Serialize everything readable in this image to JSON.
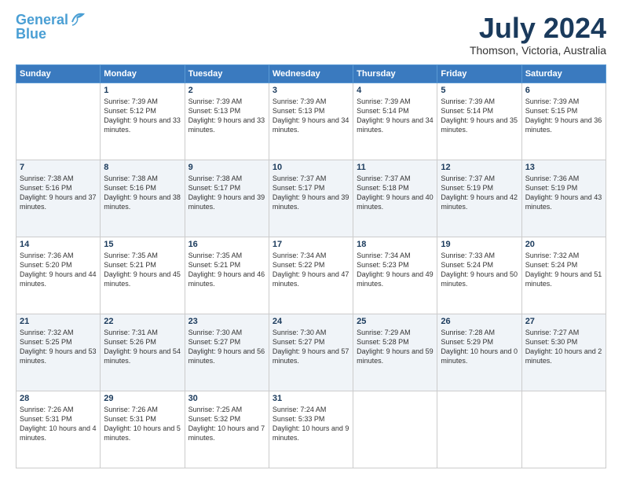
{
  "logo": {
    "line1": "General",
    "line2": "Blue"
  },
  "title": "July 2024",
  "subtitle": "Thomson, Victoria, Australia",
  "weekdays": [
    "Sunday",
    "Monday",
    "Tuesday",
    "Wednesday",
    "Thursday",
    "Friday",
    "Saturday"
  ],
  "weeks": [
    [
      {
        "day": "",
        "sunrise": "",
        "sunset": "",
        "daylight": ""
      },
      {
        "day": "1",
        "sunrise": "Sunrise: 7:39 AM",
        "sunset": "Sunset: 5:12 PM",
        "daylight": "Daylight: 9 hours and 33 minutes."
      },
      {
        "day": "2",
        "sunrise": "Sunrise: 7:39 AM",
        "sunset": "Sunset: 5:13 PM",
        "daylight": "Daylight: 9 hours and 33 minutes."
      },
      {
        "day": "3",
        "sunrise": "Sunrise: 7:39 AM",
        "sunset": "Sunset: 5:13 PM",
        "daylight": "Daylight: 9 hours and 34 minutes."
      },
      {
        "day": "4",
        "sunrise": "Sunrise: 7:39 AM",
        "sunset": "Sunset: 5:14 PM",
        "daylight": "Daylight: 9 hours and 34 minutes."
      },
      {
        "day": "5",
        "sunrise": "Sunrise: 7:39 AM",
        "sunset": "Sunset: 5:14 PM",
        "daylight": "Daylight: 9 hours and 35 minutes."
      },
      {
        "day": "6",
        "sunrise": "Sunrise: 7:39 AM",
        "sunset": "Sunset: 5:15 PM",
        "daylight": "Daylight: 9 hours and 36 minutes."
      }
    ],
    [
      {
        "day": "7",
        "sunrise": "Sunrise: 7:38 AM",
        "sunset": "Sunset: 5:16 PM",
        "daylight": "Daylight: 9 hours and 37 minutes."
      },
      {
        "day": "8",
        "sunrise": "Sunrise: 7:38 AM",
        "sunset": "Sunset: 5:16 PM",
        "daylight": "Daylight: 9 hours and 38 minutes."
      },
      {
        "day": "9",
        "sunrise": "Sunrise: 7:38 AM",
        "sunset": "Sunset: 5:17 PM",
        "daylight": "Daylight: 9 hours and 39 minutes."
      },
      {
        "day": "10",
        "sunrise": "Sunrise: 7:37 AM",
        "sunset": "Sunset: 5:17 PM",
        "daylight": "Daylight: 9 hours and 39 minutes."
      },
      {
        "day": "11",
        "sunrise": "Sunrise: 7:37 AM",
        "sunset": "Sunset: 5:18 PM",
        "daylight": "Daylight: 9 hours and 40 minutes."
      },
      {
        "day": "12",
        "sunrise": "Sunrise: 7:37 AM",
        "sunset": "Sunset: 5:19 PM",
        "daylight": "Daylight: 9 hours and 42 minutes."
      },
      {
        "day": "13",
        "sunrise": "Sunrise: 7:36 AM",
        "sunset": "Sunset: 5:19 PM",
        "daylight": "Daylight: 9 hours and 43 minutes."
      }
    ],
    [
      {
        "day": "14",
        "sunrise": "Sunrise: 7:36 AM",
        "sunset": "Sunset: 5:20 PM",
        "daylight": "Daylight: 9 hours and 44 minutes."
      },
      {
        "day": "15",
        "sunrise": "Sunrise: 7:35 AM",
        "sunset": "Sunset: 5:21 PM",
        "daylight": "Daylight: 9 hours and 45 minutes."
      },
      {
        "day": "16",
        "sunrise": "Sunrise: 7:35 AM",
        "sunset": "Sunset: 5:21 PM",
        "daylight": "Daylight: 9 hours and 46 minutes."
      },
      {
        "day": "17",
        "sunrise": "Sunrise: 7:34 AM",
        "sunset": "Sunset: 5:22 PM",
        "daylight": "Daylight: 9 hours and 47 minutes."
      },
      {
        "day": "18",
        "sunrise": "Sunrise: 7:34 AM",
        "sunset": "Sunset: 5:23 PM",
        "daylight": "Daylight: 9 hours and 49 minutes."
      },
      {
        "day": "19",
        "sunrise": "Sunrise: 7:33 AM",
        "sunset": "Sunset: 5:24 PM",
        "daylight": "Daylight: 9 hours and 50 minutes."
      },
      {
        "day": "20",
        "sunrise": "Sunrise: 7:32 AM",
        "sunset": "Sunset: 5:24 PM",
        "daylight": "Daylight: 9 hours and 51 minutes."
      }
    ],
    [
      {
        "day": "21",
        "sunrise": "Sunrise: 7:32 AM",
        "sunset": "Sunset: 5:25 PM",
        "daylight": "Daylight: 9 hours and 53 minutes."
      },
      {
        "day": "22",
        "sunrise": "Sunrise: 7:31 AM",
        "sunset": "Sunset: 5:26 PM",
        "daylight": "Daylight: 9 hours and 54 minutes."
      },
      {
        "day": "23",
        "sunrise": "Sunrise: 7:30 AM",
        "sunset": "Sunset: 5:27 PM",
        "daylight": "Daylight: 9 hours and 56 minutes."
      },
      {
        "day": "24",
        "sunrise": "Sunrise: 7:30 AM",
        "sunset": "Sunset: 5:27 PM",
        "daylight": "Daylight: 9 hours and 57 minutes."
      },
      {
        "day": "25",
        "sunrise": "Sunrise: 7:29 AM",
        "sunset": "Sunset: 5:28 PM",
        "daylight": "Daylight: 9 hours and 59 minutes."
      },
      {
        "day": "26",
        "sunrise": "Sunrise: 7:28 AM",
        "sunset": "Sunset: 5:29 PM",
        "daylight": "Daylight: 10 hours and 0 minutes."
      },
      {
        "day": "27",
        "sunrise": "Sunrise: 7:27 AM",
        "sunset": "Sunset: 5:30 PM",
        "daylight": "Daylight: 10 hours and 2 minutes."
      }
    ],
    [
      {
        "day": "28",
        "sunrise": "Sunrise: 7:26 AM",
        "sunset": "Sunset: 5:31 PM",
        "daylight": "Daylight: 10 hours and 4 minutes."
      },
      {
        "day": "29",
        "sunrise": "Sunrise: 7:26 AM",
        "sunset": "Sunset: 5:31 PM",
        "daylight": "Daylight: 10 hours and 5 minutes."
      },
      {
        "day": "30",
        "sunrise": "Sunrise: 7:25 AM",
        "sunset": "Sunset: 5:32 PM",
        "daylight": "Daylight: 10 hours and 7 minutes."
      },
      {
        "day": "31",
        "sunrise": "Sunrise: 7:24 AM",
        "sunset": "Sunset: 5:33 PM",
        "daylight": "Daylight: 10 hours and 9 minutes."
      },
      {
        "day": "",
        "sunrise": "",
        "sunset": "",
        "daylight": ""
      },
      {
        "day": "",
        "sunrise": "",
        "sunset": "",
        "daylight": ""
      },
      {
        "day": "",
        "sunrise": "",
        "sunset": "",
        "daylight": ""
      }
    ]
  ]
}
